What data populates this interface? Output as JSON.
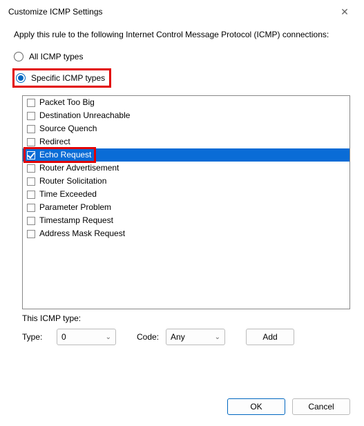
{
  "window": {
    "title": "Customize ICMP Settings",
    "close_icon": "✕"
  },
  "description": "Apply this rule to the following Internet Control Message Protocol (ICMP) connections:",
  "radios": {
    "all": {
      "label": "All ICMP types",
      "selected": false
    },
    "specific": {
      "label": "Specific ICMP types",
      "selected": true
    }
  },
  "icmp_types": [
    {
      "label": "Packet Too Big",
      "checked": false,
      "selected": false
    },
    {
      "label": "Destination Unreachable",
      "checked": false,
      "selected": false
    },
    {
      "label": "Source Quench",
      "checked": false,
      "selected": false
    },
    {
      "label": "Redirect",
      "checked": false,
      "selected": false
    },
    {
      "label": "Echo Request",
      "checked": true,
      "selected": true,
      "highlighted": true
    },
    {
      "label": "Router Advertisement",
      "checked": false,
      "selected": false
    },
    {
      "label": "Router Solicitation",
      "checked": false,
      "selected": false
    },
    {
      "label": "Time Exceeded",
      "checked": false,
      "selected": false
    },
    {
      "label": "Parameter Problem",
      "checked": false,
      "selected": false
    },
    {
      "label": "Timestamp Request",
      "checked": false,
      "selected": false
    },
    {
      "label": "Address Mask Request",
      "checked": false,
      "selected": false
    }
  ],
  "section_label": "This ICMP type:",
  "type_row": {
    "type_label": "Type:",
    "type_value": "0",
    "code_label": "Code:",
    "code_value": "Any",
    "add_label": "Add"
  },
  "footer": {
    "ok": "OK",
    "cancel": "Cancel"
  },
  "colors": {
    "accent": "#0067c0",
    "selection": "#0a6cd6",
    "highlight": "#e20000"
  }
}
